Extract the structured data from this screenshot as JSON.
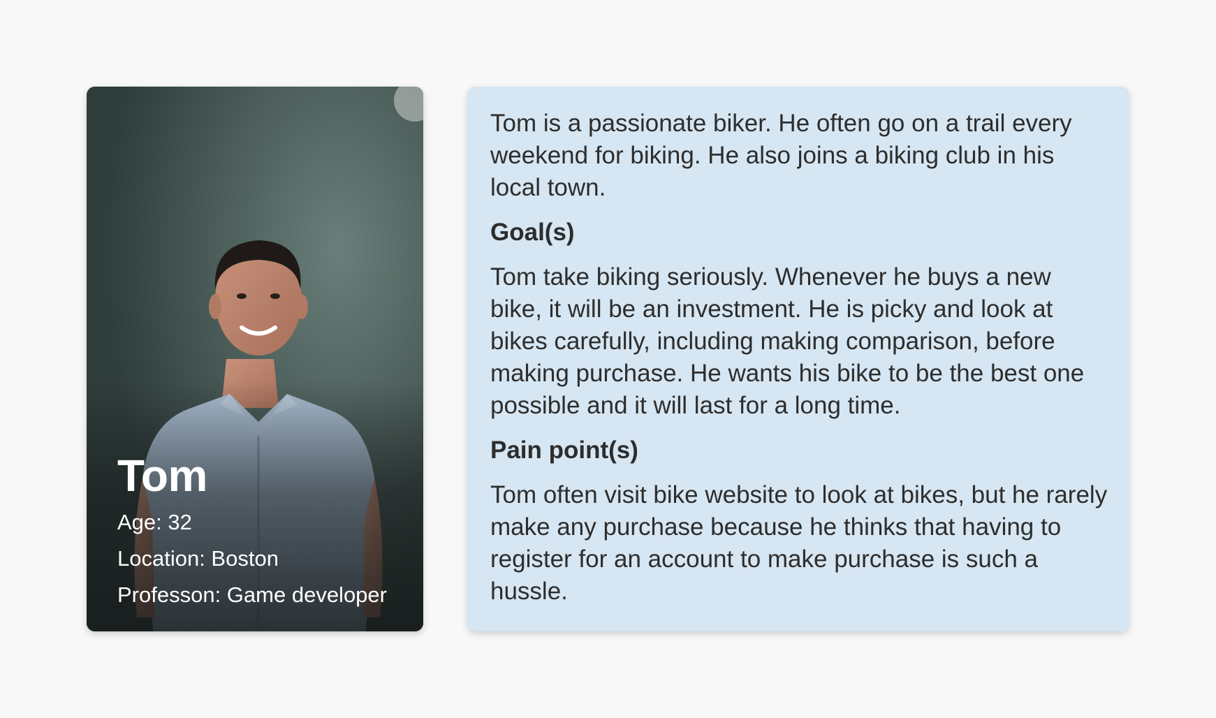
{
  "profile": {
    "name": "Tom",
    "age": "Age: 32",
    "location": "Location: Boston",
    "profession": "Professon: Game developer"
  },
  "description": {
    "intro": "Tom is a passionate biker. He often go on a trail every weekend for biking. He also joins a biking club in his local town.",
    "goals_heading": "Goal(s)",
    "goals_text": "Tom take biking seriously. Whenever he buys a new bike, it will be an investment. He is picky and look at bikes carefully, including making comparison, before making purchase. He wants his bike to be the best one possible and it will last for a long time.",
    "pain_heading": "Pain point(s)",
    "pain_text": "Tom often visit bike website to look at bikes, but he rarely make any purchase because he thinks that having to register for an account to make purchase is such a hussle."
  },
  "colors": {
    "page_background": "#f8f8f8",
    "card_background": "#d6e6f2",
    "text": "#2d2d2d"
  }
}
